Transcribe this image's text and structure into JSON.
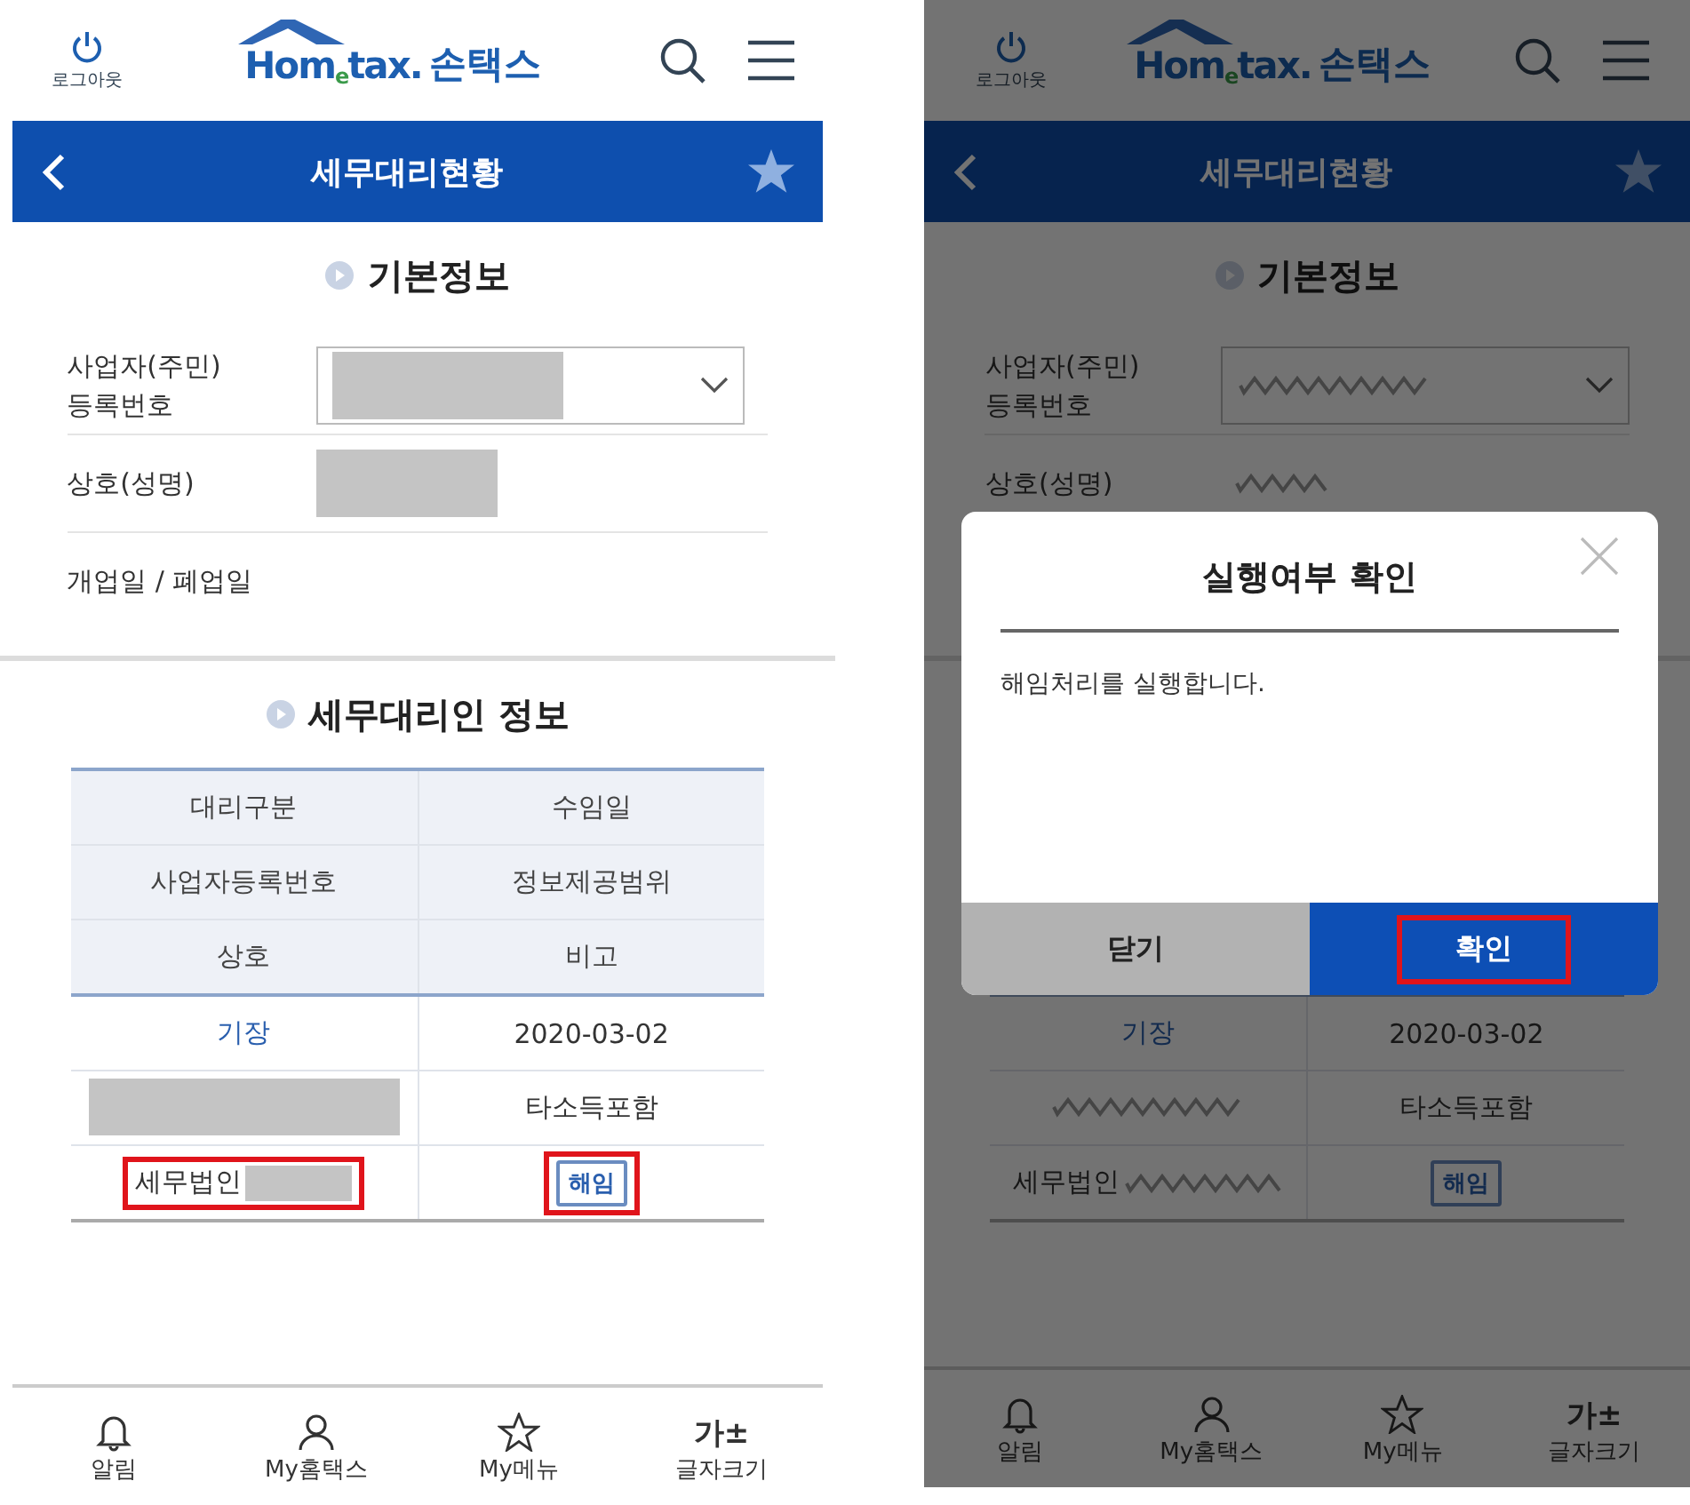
{
  "screens": [
    {
      "dimmed": false,
      "logout": "로그아웃",
      "logo": "Hom$_{e}$tax.",
      "brand": "손택스",
      "title": "세무대리현황",
      "basic": {
        "heading": "기본정보",
        "fields": [
          {
            "label": "사업자(주민)\n등록번호",
            "kind": "select"
          },
          {
            "label": "상호(성명)",
            "kind": "redacted"
          },
          {
            "label": "개업일 / 폐업일",
            "kind": "empty"
          }
        ]
      },
      "agent": {
        "heading": "세무대리인 정보",
        "header_rows": [
          [
            "대리구분",
            "수임일"
          ],
          [
            "사업자등록번호",
            "정보제공범위"
          ],
          [
            "상호",
            "비고"
          ]
        ],
        "rows": [
          [
            {
              "kind": "link",
              "text": "기장",
              "highlighted": false
            },
            {
              "kind": "text",
              "text": "2020-03-02",
              "highlighted": false
            }
          ],
          [
            {
              "kind": "redacted",
              "highlighted": false
            },
            {
              "kind": "text",
              "text": "타소득포함",
              "highlighted": false
            }
          ],
          [
            {
              "kind": "redacted_suffix",
              "text": "세무법인",
              "highlighted": true
            },
            {
              "kind": "button",
              "text": "해임",
              "highlighted": true
            }
          ]
        ]
      },
      "tabbar": [
        {
          "kind": "bell",
          "label": "알림"
        },
        {
          "kind": "person",
          "label": "My홈택스"
        },
        {
          "kind": "star",
          "label": "My메뉴"
        },
        {
          "kind": "text",
          "icon_text": "가±",
          "label": "글자크기"
        }
      ]
    },
    {
      "dimmed": true,
      "logout": "로그아웃",
      "logo": "Hom$_{e}$tax.",
      "brand": "손택스",
      "title": "세무대리현황",
      "basic": {
        "heading": "기본정보",
        "fields": [
          {
            "label": "사업자(주민)\n등록번호",
            "kind": "select"
          },
          {
            "label": "상호(성명)",
            "kind": "redacted"
          }
        ]
      },
      "agent": {
        "rows": [
          [
            {
              "kind": "link",
              "text": "기장",
              "highlighted": false
            },
            {
              "kind": "text",
              "text": "2020-03-02",
              "highlighted": false
            }
          ],
          [
            {
              "kind": "redacted",
              "highlighted": false
            },
            {
              "kind": "text",
              "text": "타소득포함",
              "highlighted": false
            }
          ],
          [
            {
              "kind": "redacted_suffix",
              "text": "세무법인",
              "highlighted": false
            },
            {
              "kind": "button",
              "text": "해임",
              "highlighted": false
            }
          ]
        ]
      },
      "tabbar": [
        {
          "kind": "bell",
          "label": "알림"
        },
        {
          "kind": "person",
          "label": "My홈택스"
        },
        {
          "kind": "star",
          "label": "My메뉴"
        },
        {
          "kind": "text",
          "icon_text": "가±",
          "label": "글자크기"
        }
      ],
      "dialog": {
        "title": "실행여부 확인",
        "message": "해임처리를 실행합니다.",
        "buttons": [
          {
            "kind": "cancel",
            "label": "닫기",
            "highlighted": false
          },
          {
            "kind": "confirm",
            "label": "확인",
            "highlighted": true
          }
        ]
      }
    }
  ]
}
